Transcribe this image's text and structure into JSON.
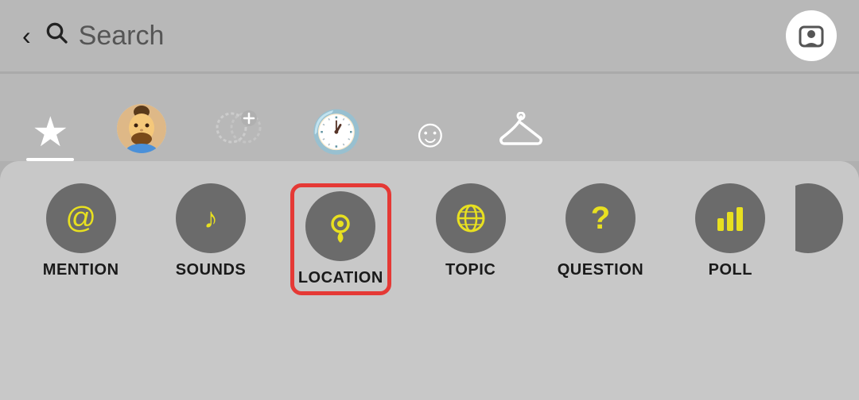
{
  "header": {
    "back_label": "<",
    "search_placeholder": "Search",
    "profile_button_label": "Profile"
  },
  "tabs": [
    {
      "id": "favorites",
      "icon": "★",
      "active": true
    },
    {
      "id": "avatar",
      "icon": "avatar",
      "active": false
    },
    {
      "id": "add",
      "icon": "add-bubble",
      "active": false
    },
    {
      "id": "recent",
      "icon": "🕐",
      "active": false
    },
    {
      "id": "emoji",
      "icon": "☺",
      "active": false
    },
    {
      "id": "hanger",
      "icon": "hanger",
      "active": false
    }
  ],
  "stickers": [
    {
      "id": "mention",
      "icon": "@",
      "label": "MENTION",
      "highlighted": false
    },
    {
      "id": "sounds",
      "icon": "♪",
      "label": "SOUNDS",
      "highlighted": false
    },
    {
      "id": "location",
      "icon": "📍",
      "label": "LOCATION",
      "highlighted": true
    },
    {
      "id": "topic",
      "icon": "🌐",
      "label": "TOPIC",
      "highlighted": false
    },
    {
      "id": "question",
      "icon": "?",
      "label": "QUESTION",
      "highlighted": false
    },
    {
      "id": "poll",
      "icon": "poll",
      "label": "POLL",
      "highlighted": false
    },
    {
      "id": "more",
      "icon": "S",
      "label": "",
      "highlighted": false
    }
  ],
  "colors": {
    "accent_yellow": "#e8e020",
    "highlight_red": "#e53935",
    "dark_circle": "#6b6b6b",
    "header_bg": "#b8b8b8",
    "content_bg": "#c8c8c8"
  }
}
